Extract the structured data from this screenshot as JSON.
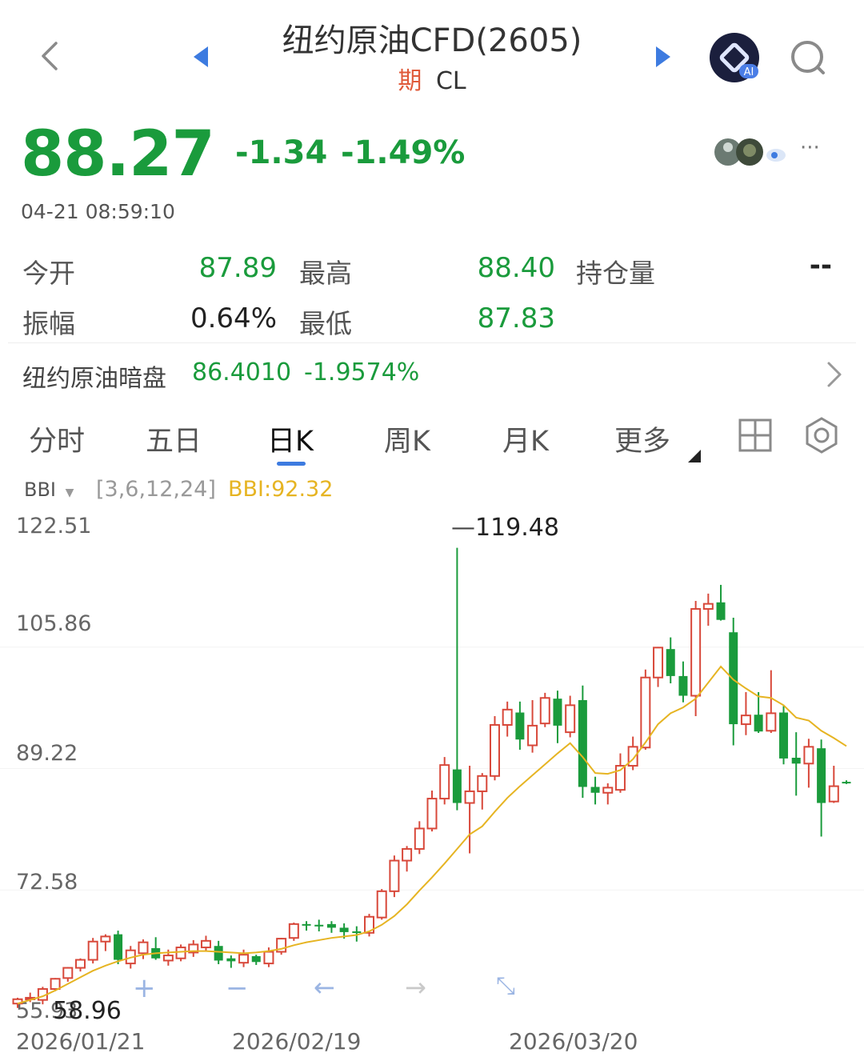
{
  "header": {
    "title": "纽约原油CFD(2605)",
    "badge": "期",
    "code": "CL"
  },
  "quote": {
    "price": "88.27",
    "change": "-1.34",
    "change_pct": "-1.49%",
    "timestamp": "04-21 08:59:10",
    "more": "···"
  },
  "stats": {
    "open_label": "今开",
    "open_value": "87.89",
    "high_label": "最高",
    "high_value": "88.40",
    "oi_label": "持仓量",
    "oi_value": "--",
    "amp_label": "振幅",
    "amp_value": "0.64%",
    "low_label": "最低",
    "low_value": "87.83"
  },
  "dark_pool": {
    "label": "纽约原油暗盘",
    "value": "86.4010",
    "pct": "-1.9574%"
  },
  "tabs": [
    "分时",
    "五日",
    "日K",
    "周K",
    "月K",
    "更多"
  ],
  "active_tab": "日K",
  "indicator": {
    "name": "BBI",
    "params": "[3,6,12,24]",
    "value_label": "BBI:92.32"
  },
  "colors": {
    "up": "#d8483a",
    "down": "#1a9b3c",
    "bbi": "#e6b422",
    "accent": "#3d7be0"
  },
  "chart_data": {
    "type": "candlestick",
    "y_ticks": [
      "122.51",
      "105.86",
      "89.22",
      "72.58",
      "55.93"
    ],
    "ylim": [
      55.93,
      122.51
    ],
    "x_tick_labels": [
      "2026/01/21",
      "2026/02/19",
      "2026/03/20"
    ],
    "max_label": "119.48",
    "min_label": "58.96",
    "ohlc": [
      [
        57.0,
        57.8,
        56.4,
        57.6
      ],
      [
        57.6,
        58.5,
        57.2,
        57.8
      ],
      [
        57.5,
        59.3,
        56.9,
        59.0
      ],
      [
        59.0,
        60.5,
        58.7,
        60.4
      ],
      [
        60.5,
        62.0,
        60.0,
        61.9
      ],
      [
        61.9,
        63.2,
        61.4,
        63.0
      ],
      [
        63.0,
        66.0,
        62.5,
        65.5
      ],
      [
        65.5,
        66.5,
        64.2,
        66.2
      ],
      [
        66.5,
        67.0,
        62.4,
        63.0
      ],
      [
        62.5,
        64.9,
        61.8,
        64.3
      ],
      [
        63.9,
        65.8,
        63.1,
        65.4
      ],
      [
        64.6,
        66.1,
        63.0,
        63.2
      ],
      [
        62.9,
        64.4,
        62.2,
        63.6
      ],
      [
        63.2,
        65.1,
        62.8,
        64.7
      ],
      [
        64.0,
        65.7,
        63.4,
        65.1
      ],
      [
        64.7,
        66.3,
        64.2,
        65.6
      ],
      [
        64.9,
        65.6,
        62.4,
        62.9
      ],
      [
        63.2,
        63.6,
        61.9,
        62.8
      ],
      [
        62.6,
        64.4,
        62.0,
        63.7
      ],
      [
        63.5,
        63.7,
        62.3,
        62.7
      ],
      [
        62.5,
        64.7,
        62.0,
        64.1
      ],
      [
        64.1,
        66.0,
        63.7,
        65.9
      ],
      [
        66.0,
        68.1,
        65.6,
        67.9
      ],
      [
        67.9,
        68.3,
        67.0,
        67.7
      ],
      [
        67.8,
        68.5,
        66.9,
        67.6
      ],
      [
        67.9,
        68.3,
        66.7,
        67.4
      ],
      [
        67.4,
        68.0,
        65.9,
        66.8
      ],
      [
        66.9,
        67.6,
        65.5,
        66.7
      ],
      [
        66.7,
        69.3,
        66.2,
        68.9
      ],
      [
        68.8,
        72.7,
        68.5,
        72.4
      ],
      [
        72.4,
        77.3,
        71.6,
        76.6
      ],
      [
        76.6,
        78.6,
        75.1,
        78.2
      ],
      [
        78.2,
        82.0,
        77.5,
        81.0
      ],
      [
        81.0,
        86.2,
        80.6,
        85.1
      ],
      [
        85.1,
        90.8,
        84.3,
        89.7
      ],
      [
        89.1,
        119.48,
        83.5,
        84.5
      ],
      [
        84.5,
        89.6,
        77.6,
        86.1
      ],
      [
        86.1,
        88.6,
        83.6,
        88.2
      ],
      [
        88.2,
        96.4,
        87.6,
        95.2
      ],
      [
        95.2,
        98.4,
        93.6,
        97.3
      ],
      [
        96.9,
        98.4,
        91.8,
        93.2
      ],
      [
        92.4,
        98.6,
        91.4,
        95.1
      ],
      [
        95.4,
        99.6,
        94.9,
        98.9
      ],
      [
        98.8,
        99.9,
        92.7,
        95.1
      ],
      [
        94.2,
        99.2,
        93.5,
        97.9
      ],
      [
        98.6,
        100.6,
        85.2,
        86.7
      ],
      [
        86.7,
        88.1,
        84.3,
        85.9
      ],
      [
        85.9,
        87.2,
        84.3,
        86.6
      ],
      [
        86.3,
        91.3,
        85.9,
        89.6
      ],
      [
        89.6,
        93.6,
        89.0,
        92.2
      ],
      [
        92.1,
        102.8,
        91.8,
        101.7
      ],
      [
        101.7,
        105.9,
        100.4,
        105.8
      ],
      [
        105.6,
        107.2,
        100.9,
        101.9
      ],
      [
        101.9,
        103.9,
        98.3,
        99.2
      ],
      [
        99.2,
        112.2,
        96.4,
        111.1
      ],
      [
        111.1,
        113.2,
        108.8,
        111.8
      ],
      [
        112.0,
        114.4,
        109.5,
        109.6
      ],
      [
        107.9,
        109.9,
        92.4,
        95.3
      ],
      [
        95.3,
        99.7,
        93.8,
        96.5
      ],
      [
        96.6,
        99.7,
        94.1,
        94.3
      ],
      [
        94.4,
        102.7,
        94.1,
        96.8
      ],
      [
        96.9,
        97.8,
        89.8,
        90.6
      ],
      [
        90.7,
        94.2,
        85.5,
        89.9
      ],
      [
        89.9,
        93.3,
        86.6,
        92.2
      ],
      [
        92.0,
        93.2,
        79.9,
        84.5
      ],
      [
        84.7,
        89.6,
        84.5,
        86.8
      ],
      [
        87.4,
        87.6,
        87.1,
        87.3
      ]
    ],
    "bbi": [
      57.0,
      57.5,
      58.0,
      58.8,
      59.7,
      60.6,
      61.5,
      62.2,
      62.8,
      63.3,
      63.7,
      63.9,
      64.0,
      64.1,
      64.2,
      64.2,
      64.1,
      64.0,
      63.9,
      64.0,
      64.2,
      64.5,
      65.0,
      65.4,
      65.7,
      66.0,
      66.2,
      66.4,
      66.9,
      67.8,
      69.0,
      70.6,
      72.5,
      74.3,
      76.2,
      78.2,
      80.2,
      81.3,
      83.3,
      85.2,
      86.8,
      88.3,
      89.8,
      91.3,
      92.7,
      90.8,
      88.6,
      88.5,
      89.0,
      90.5,
      92.8,
      95.3,
      96.8,
      97.6,
      98.8,
      101.0,
      103.2,
      101.4,
      100.2,
      99.1,
      98.9,
      97.9,
      96.2,
      95.8,
      94.4,
      93.4,
      92.3
    ]
  },
  "chart_controls": [
    "+",
    "−",
    "←",
    "→",
    "⤡"
  ]
}
